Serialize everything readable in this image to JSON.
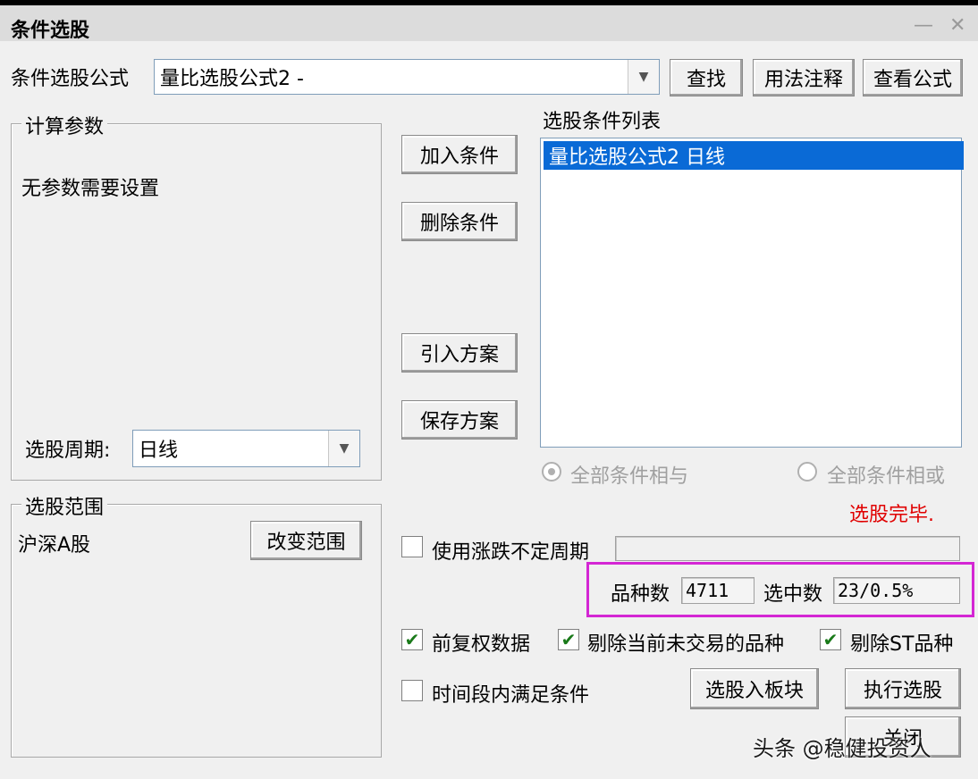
{
  "window": {
    "title": "条件选股",
    "minimize": "—",
    "close": "✕"
  },
  "formula": {
    "label": "条件选股公式",
    "value": "量比选股公式2 -",
    "find_button": "查找",
    "usage_button": "用法注释",
    "view_button": "查看公式"
  },
  "params": {
    "group_label": "计算参数",
    "message": "无参数需要设置",
    "period_label": "选股周期:",
    "period_value": "日线"
  },
  "actions": {
    "add": "加入条件",
    "delete": "删除条件",
    "import": "引入方案",
    "save": "保存方案"
  },
  "conditions": {
    "label": "选股条件列表",
    "items": [
      "量比选股公式2   日线"
    ],
    "and_label": "全部条件相与",
    "or_label": "全部条件相或",
    "status": "选股完毕."
  },
  "scope": {
    "group_label": "选股范围",
    "value": "沪深A股",
    "change_button": "改变范围"
  },
  "options": {
    "variable_period_label": "使用涨跌不定周期",
    "count_label": "品种数",
    "count_value": "4711",
    "selected_label": "选中数",
    "selected_value": "23/0.5%",
    "adjusted_label": "前复权数据",
    "exclude_untraded_label": "剔除当前未交易的品种",
    "exclude_st_label": "剔除ST品种",
    "time_range_label": "时间段内满足条件",
    "adjusted_checked": true,
    "exclude_untraded_checked": true,
    "exclude_st_checked": true,
    "time_range_checked": false,
    "variable_period_checked": false
  },
  "bottom": {
    "to_block_button": "选股入板块",
    "execute_button": "执行选股",
    "close_button": "关闭"
  },
  "watermark": "头条 @稳健投资人",
  "colors": {
    "selection": "#0a6ad6",
    "status_red": "#e00000",
    "highlight": "#d426d4"
  }
}
